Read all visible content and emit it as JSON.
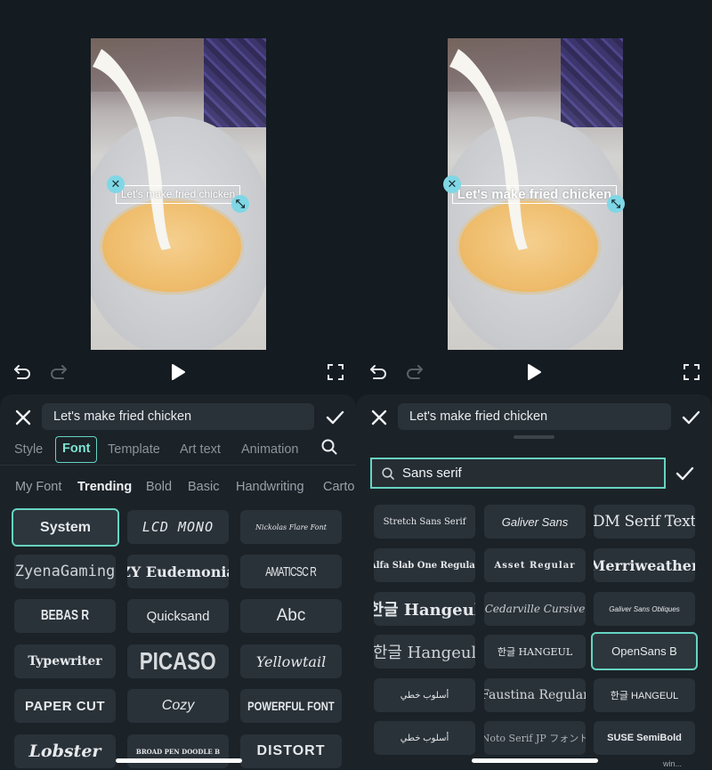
{
  "left": {
    "caption": "Let's make fried chicken",
    "text_field_value": "Let's make fried chicken",
    "tabs": [
      {
        "label": "Style"
      },
      {
        "label": "Font"
      },
      {
        "label": "Template"
      },
      {
        "label": "Art text"
      },
      {
        "label": "Animation"
      }
    ],
    "active_tab": "Font",
    "categories": [
      {
        "label": "My Font"
      },
      {
        "label": "Trending"
      },
      {
        "label": "Bold"
      },
      {
        "label": "Basic"
      },
      {
        "label": "Handwriting"
      },
      {
        "label": "Carto"
      }
    ],
    "active_category": "Trending",
    "fonts": [
      {
        "label": "System"
      },
      {
        "label": "LCD MONO"
      },
      {
        "label": "Nickolas Flare Font"
      },
      {
        "label": "ZyenaGaming"
      },
      {
        "label": "ZY Eudemonia"
      },
      {
        "label": "AMATICSC R"
      },
      {
        "label": "BEBAS R"
      },
      {
        "label": "Quicksand"
      },
      {
        "label": "Abc"
      },
      {
        "label": "Typewriter"
      },
      {
        "label": "PICASO"
      },
      {
        "label": "Yellowtail"
      },
      {
        "label": "PAPER CUT"
      },
      {
        "label": "Cozy"
      },
      {
        "label": "POWERFUL FONT"
      },
      {
        "label": "Lobster"
      },
      {
        "label": "BROAD PEN DOODLE B"
      },
      {
        "label": "DISTORT"
      }
    ],
    "selected_font": "System"
  },
  "right": {
    "caption": "Let's make fried chicken",
    "text_field_value": "Let's make fried chicken",
    "search_value": "Sans serif",
    "fonts": [
      {
        "label": "Stretch Sans Serif"
      },
      {
        "label": "Galiver Sans"
      },
      {
        "label": "DM Serif Text"
      },
      {
        "label": "Alfa Slab One Regular"
      },
      {
        "label": "Asset Regular"
      },
      {
        "label": "Merriweather"
      },
      {
        "label": "한글 Hangeul"
      },
      {
        "label": "Cedarville Cursive"
      },
      {
        "label": "Galiver Sans Obliques"
      },
      {
        "label": "한글 Hangeul"
      },
      {
        "label": "한글 HANGEUL"
      },
      {
        "label": "OpenSans B"
      },
      {
        "label": "أسلوب خطي"
      },
      {
        "label": "Faustina Regular"
      },
      {
        "label": "한글 HANGEUL"
      },
      {
        "label": "أسلوب خطي"
      },
      {
        "label": "Noto Serif JP フォント"
      },
      {
        "label": "SUSE SemiBold"
      }
    ],
    "selected_font": "OpenSans B"
  },
  "watermark": "win...",
  "icons": {
    "undo": "undo-icon",
    "redo": "redo-icon",
    "play": "play-icon",
    "fullscreen": "fullscreen-icon",
    "close": "close-icon",
    "confirm": "check-icon",
    "search": "search-icon",
    "delete_handle": "close-handle-icon",
    "resize_handle": "resize-handle-icon"
  },
  "colors": {
    "accent": "#67d3c2",
    "background": "#141b21",
    "sheet": "#1b2228",
    "tile": "#2a3239",
    "handle": "#7fd7e6"
  }
}
